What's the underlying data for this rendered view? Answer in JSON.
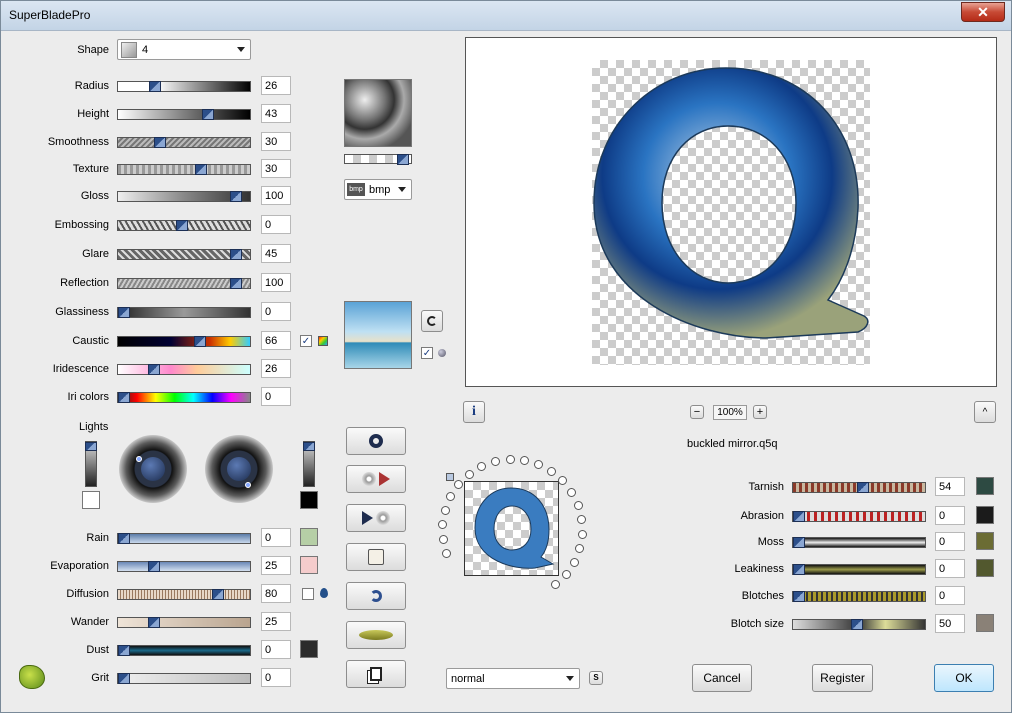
{
  "window": {
    "title": "SuperBladePro"
  },
  "shape": {
    "label": "Shape",
    "value": "4"
  },
  "params": [
    {
      "label": "Radius",
      "value": "26",
      "thumb": 0.26
    },
    {
      "label": "Height",
      "value": "43",
      "thumb": 0.7
    },
    {
      "label": "Smoothness",
      "value": "30",
      "thumb": 0.3
    },
    {
      "label": "Texture",
      "value": "30",
      "thumb": 0.64
    },
    {
      "label": "Gloss",
      "value": "100",
      "thumb": 0.93
    },
    {
      "label": "Embossing",
      "value": "0",
      "thumb": 0.48
    },
    {
      "label": "Glare",
      "value": "45",
      "thumb": 0.93
    },
    {
      "label": "Reflection",
      "value": "100",
      "thumb": 0.93
    },
    {
      "label": "Glassiness",
      "value": "0",
      "thumb": 0.0
    },
    {
      "label": "Caustic",
      "value": "66",
      "thumb": 0.63
    },
    {
      "label": "Iridescence",
      "value": "26",
      "thumb": 0.25
    },
    {
      "label": "Iri colors",
      "value": "0",
      "thumb": 0.0
    }
  ],
  "texture": {
    "format": "bmp",
    "format_icon": "bmp"
  },
  "lights": {
    "label": "Lights"
  },
  "weather": [
    {
      "label": "Rain",
      "value": "0",
      "thumb": 0.0,
      "color": "#b6cfa6"
    },
    {
      "label": "Evaporation",
      "value": "25",
      "thumb": 0.25,
      "color": "#f5cccc"
    },
    {
      "label": "Diffusion",
      "value": "80",
      "thumb": 0.78
    },
    {
      "label": "Wander",
      "value": "25",
      "thumb": 0.25
    },
    {
      "label": "Dust",
      "value": "0",
      "thumb": 0.0,
      "color": "#2b2b2b"
    },
    {
      "label": "Grit",
      "value": "0",
      "thumb": 0.0
    }
  ],
  "preview": {
    "zoom": "100%",
    "filename": "buckled mirror.q5q"
  },
  "blend": {
    "value": "normal",
    "s_label": "S"
  },
  "aging": [
    {
      "label": "Tarnish",
      "value": "54",
      "thumb": 0.53,
      "color": "#2d4a42"
    },
    {
      "label": "Abrasion",
      "value": "0",
      "thumb": 0.0,
      "color": "#1b1b1b"
    },
    {
      "label": "Moss",
      "value": "0",
      "thumb": 0.0,
      "color": "#6b6c34"
    },
    {
      "label": "Leakiness",
      "value": "0",
      "thumb": 0.0,
      "color": "#52582e"
    },
    {
      "label": "Blotches",
      "value": "0",
      "thumb": 0.0
    },
    {
      "label": "Blotch size",
      "value": "50",
      "thumb": 0.48,
      "color": "#8a8177"
    }
  ],
  "buttons": {
    "cancel": "Cancel",
    "register": "Register",
    "ok": "OK"
  },
  "glyphs": {
    "info": "i",
    "minus": "−",
    "plus": "+",
    "up": "^",
    "check": "✓",
    "close": "✕"
  }
}
